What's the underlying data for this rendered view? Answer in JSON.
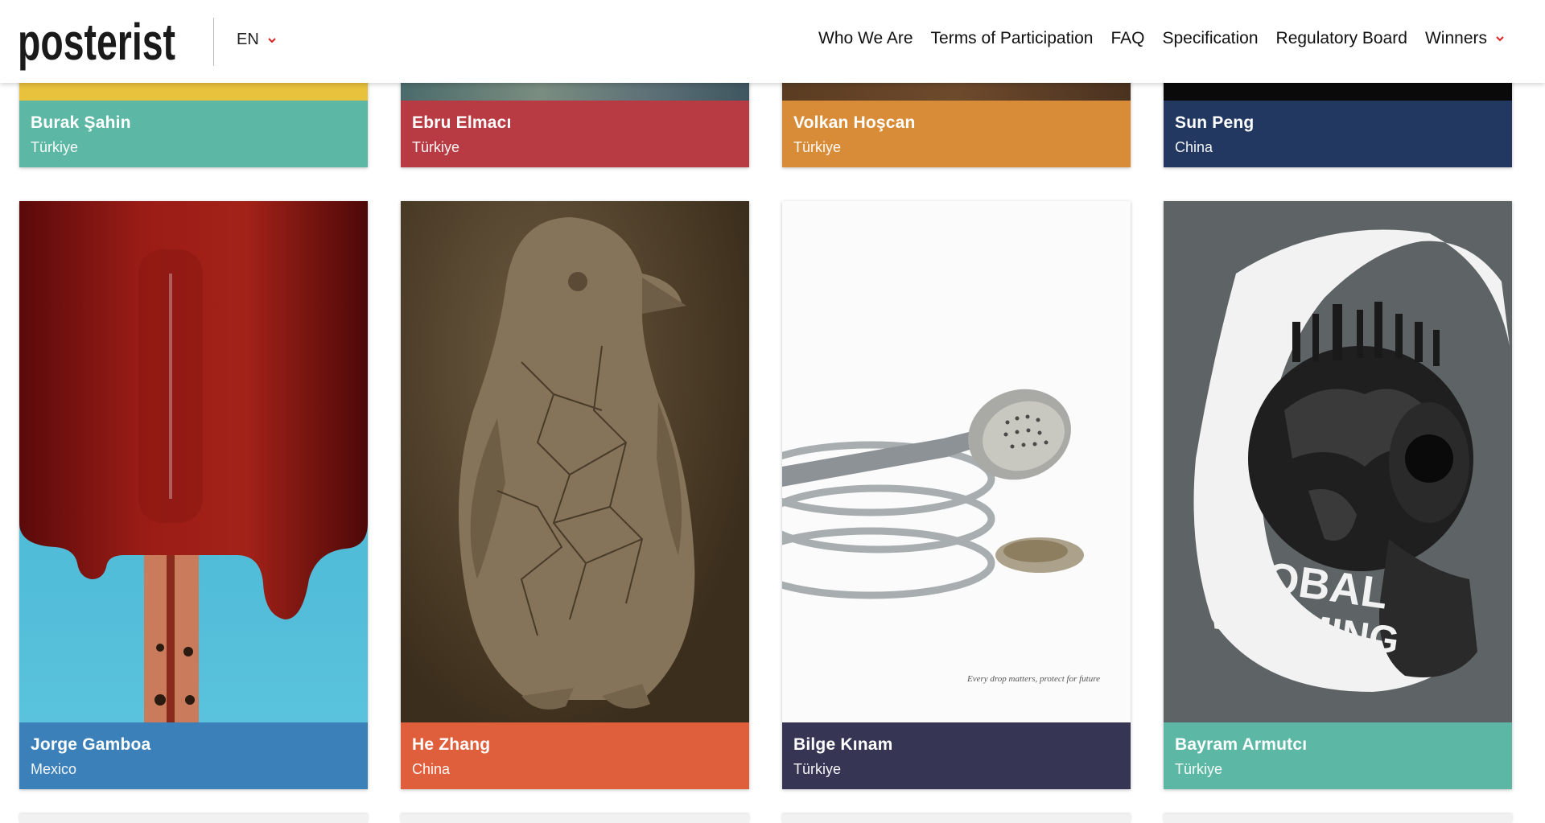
{
  "header": {
    "logo_text": "posterist",
    "language": "EN",
    "nav": [
      {
        "label": "Who We Are"
      },
      {
        "label": "Terms of Participation"
      },
      {
        "label": "FAQ"
      },
      {
        "label": "Specification"
      },
      {
        "label": "Regulatory Board"
      },
      {
        "label": "Winners"
      }
    ]
  },
  "row1": [
    {
      "name": "Burak Şahin",
      "country": "Türkiye",
      "color": "#5cb8a4"
    },
    {
      "name": "Ebru Elmacı",
      "country": "Türkiye",
      "color": "#b83a42"
    },
    {
      "name": "Volkan Hoşcan",
      "country": "Türkiye",
      "color": "#d98c38"
    },
    {
      "name": "Sun Peng",
      "country": "China",
      "color": "#223861"
    }
  ],
  "row2": [
    {
      "name": "Jorge Gamboa",
      "country": "Mexico",
      "color": "#3b80b8",
      "poster": "thermometer-popsicle-poster"
    },
    {
      "name": "He Zhang",
      "country": "China",
      "color": "#df5f3c",
      "poster": "cracked-penguin-poster"
    },
    {
      "name": "Bilge Kınam",
      "country": "Türkiye",
      "color": "#363654",
      "poster": "shower-head-poster",
      "poster_caption": "Every drop matters, protect for future"
    },
    {
      "name": "Bayram Armutcı",
      "country": "Türkiye",
      "color": "#5cb8a4",
      "poster": "global-warming-poster",
      "poster_text_1": "GLOBAL",
      "poster_text_2": "WARMING"
    }
  ]
}
